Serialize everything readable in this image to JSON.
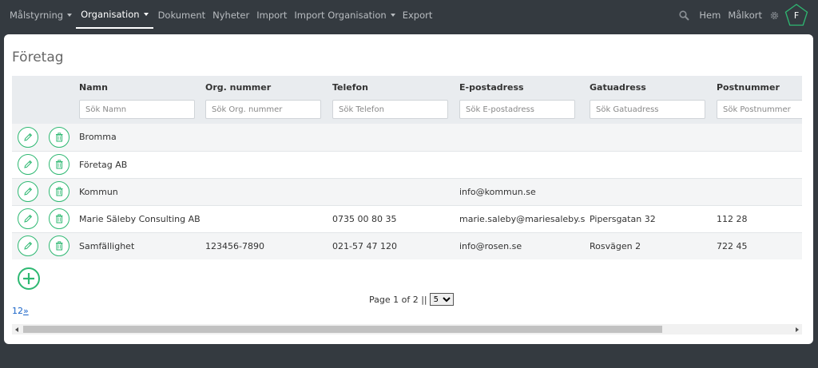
{
  "nav": {
    "items": [
      {
        "label": "Målstyrning",
        "caret": true,
        "active": false
      },
      {
        "label": "Organisation",
        "caret": true,
        "active": true
      },
      {
        "label": "Dokument",
        "caret": false,
        "active": false
      },
      {
        "label": "Nyheter",
        "caret": false,
        "active": false
      },
      {
        "label": "Import",
        "caret": false,
        "active": false
      },
      {
        "label": "Import Organisation",
        "caret": true,
        "active": false
      },
      {
        "label": "Export",
        "caret": false,
        "active": false
      }
    ],
    "right": {
      "home_label": "Hem",
      "goals_label": "Målkort",
      "avatar_letter": "F"
    }
  },
  "page": {
    "title": "Företag"
  },
  "table": {
    "columns": [
      {
        "label": "Namn",
        "placeholder": "Sök Namn"
      },
      {
        "label": "Org. nummer",
        "placeholder": "Sök Org. nummer"
      },
      {
        "label": "Telefon",
        "placeholder": "Sök Telefon"
      },
      {
        "label": "E-postadress",
        "placeholder": "Sök E-postadress"
      },
      {
        "label": "Gatuadress",
        "placeholder": "Sök Gatuadress"
      },
      {
        "label": "Postnummer",
        "placeholder": "Sök Postnummer"
      }
    ],
    "rows": [
      {
        "name": "Bromma",
        "org": "",
        "phone": "",
        "email": "",
        "street": "",
        "zip": ""
      },
      {
        "name": "Företag AB",
        "org": "",
        "phone": "",
        "email": "",
        "street": "",
        "zip": ""
      },
      {
        "name": "Kommun",
        "org": "",
        "phone": "",
        "email": "info@kommun.se",
        "street": "",
        "zip": ""
      },
      {
        "name": "Marie Säleby Consulting AB",
        "org": "",
        "phone": "0735 00 80 35",
        "email": "marie.saleby@mariesaleby.se",
        "street": "Pipersgatan 32",
        "zip": "112 28"
      },
      {
        "name": "Samfällighet",
        "org": "123456-7890",
        "phone": "021-57 47 120",
        "email": "info@rosen.se",
        "street": "Rosvägen 2",
        "zip": "722 45"
      }
    ]
  },
  "pager": {
    "text": "Page 1 of 2 ||",
    "page_size": "5",
    "links": [
      "1",
      "2",
      "»"
    ]
  },
  "colors": {
    "accent": "#2eb872",
    "nav_bg": "#343a40",
    "link": "#1a64c8"
  }
}
